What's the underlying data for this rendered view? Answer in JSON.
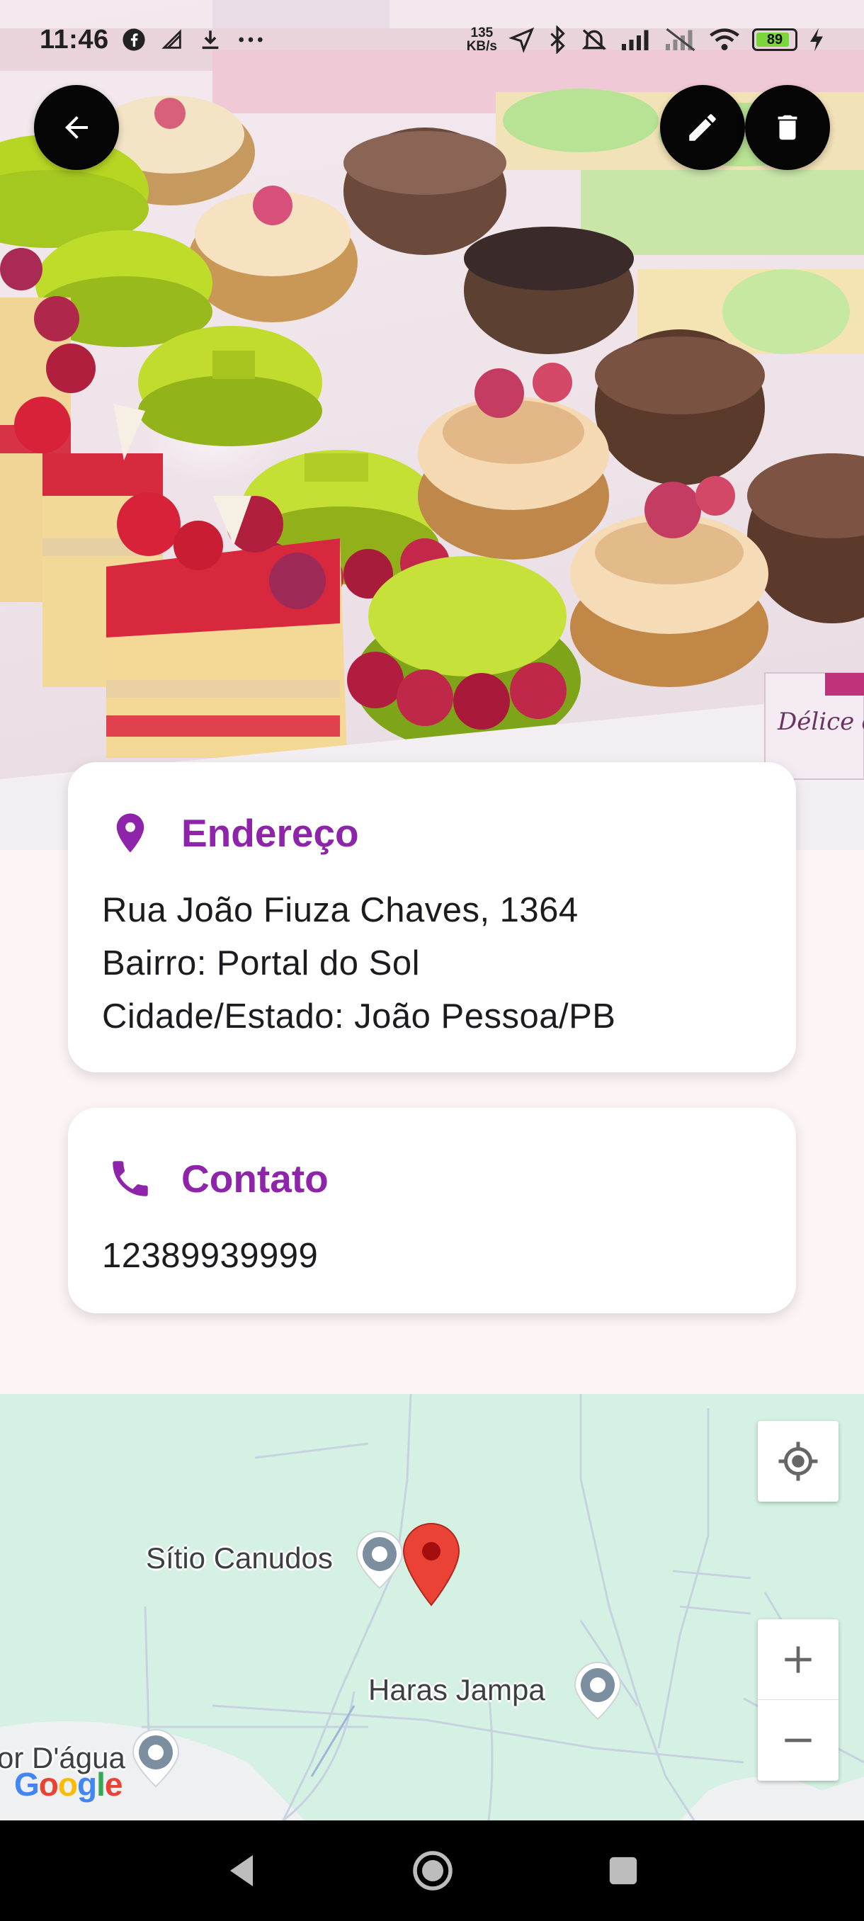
{
  "status_bar": {
    "time": "11:46",
    "net_speed_value": "135",
    "net_speed_unit": "KB/s",
    "battery_level": "89",
    "battery_fraction": 0.89
  },
  "actions": {
    "back_icon": "arrow-left-icon",
    "edit_icon": "pencil-icon",
    "delete_icon": "trash-icon"
  },
  "address_card": {
    "title": "Endereço",
    "icon": "location-pin-icon",
    "lines": [
      "Rua João Fiuza Chaves, 1364",
      "Bairro: Portal do Sol",
      "Cidade/Estado: João Pessoa/PB"
    ]
  },
  "contact_card": {
    "title": "Contato",
    "icon": "phone-icon",
    "phone": "12389939999"
  },
  "map": {
    "places": [
      "Sítio Canudos",
      "Haras Jampa",
      "or D'água"
    ],
    "logo_letters": [
      "G",
      "o",
      "o",
      "g",
      "l",
      "e"
    ]
  },
  "colors": {
    "accent": "#8e24aa",
    "map_background": "#d4f1e3",
    "marker": "#ea4335"
  }
}
